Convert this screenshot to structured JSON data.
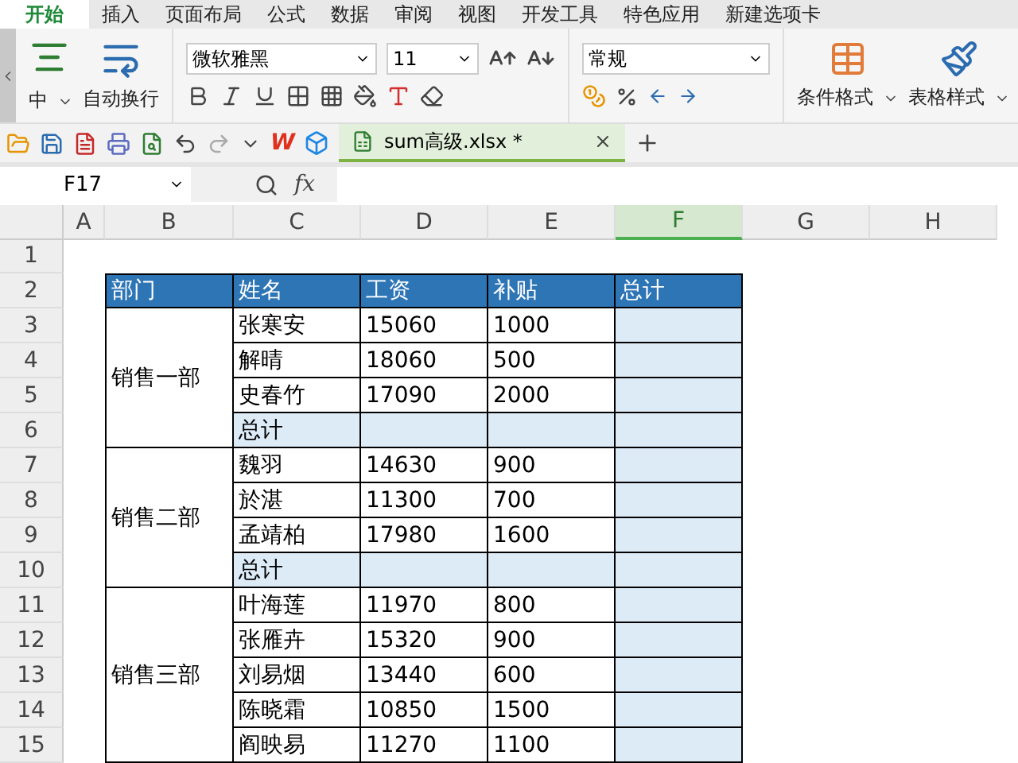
{
  "ribbon_tabs": [
    {
      "label": "开始",
      "selected": true
    },
    {
      "label": "插入",
      "selected": false
    },
    {
      "label": "页面布局",
      "selected": false
    },
    {
      "label": "公式",
      "selected": false
    },
    {
      "label": "数据",
      "selected": false
    },
    {
      "label": "审阅",
      "selected": false
    },
    {
      "label": "视图",
      "selected": false
    },
    {
      "label": "开发工具",
      "selected": false
    },
    {
      "label": "特色应用",
      "selected": false
    },
    {
      "label": "新建选项卡",
      "selected": false
    }
  ],
  "ribbon": {
    "merge_label": "中",
    "wrap_label": "自动换行",
    "font": "微软雅黑",
    "font_size": "11",
    "number_format": "常规",
    "conditional_format": "条件格式",
    "table_style": "表格样式"
  },
  "quick_toolbar": {
    "logo": "W",
    "document_tab": {
      "title": "sum高级.xlsx *"
    }
  },
  "formula_bar": {
    "name_box": "F17",
    "function_label": "fx"
  },
  "sheet": {
    "columns": [
      {
        "label": "A",
        "selected": false
      },
      {
        "label": "B",
        "selected": false
      },
      {
        "label": "C",
        "selected": false
      },
      {
        "label": "D",
        "selected": false
      },
      {
        "label": "E",
        "selected": false
      },
      {
        "label": "F",
        "selected": true
      },
      {
        "label": "G",
        "selected": false
      },
      {
        "label": "H",
        "selected": false
      }
    ],
    "row_numbers": [
      "1",
      "2",
      "3",
      "4",
      "5",
      "6",
      "7",
      "8",
      "9",
      "10",
      "11",
      "12",
      "13",
      "14",
      "15"
    ],
    "header": [
      "部门",
      "姓名",
      "工资",
      "补贴",
      "总计"
    ],
    "groups": [
      {
        "department": "销售一部",
        "rows": [
          {
            "kind": "person",
            "cells": [
              "张寒安",
              "15060",
              "1000"
            ]
          },
          {
            "kind": "person",
            "cells": [
              "解晴",
              "18060",
              "500"
            ]
          },
          {
            "kind": "person",
            "cells": [
              "史春竹",
              "17090",
              "2000"
            ]
          },
          {
            "kind": "subtotal",
            "cells": [
              "总计"
            ]
          }
        ]
      },
      {
        "department": "销售二部",
        "rows": [
          {
            "kind": "person",
            "cells": [
              "魏羽",
              "14630",
              "900"
            ]
          },
          {
            "kind": "person",
            "cells": [
              "於湛",
              "11300",
              "700"
            ]
          },
          {
            "kind": "person",
            "cells": [
              "孟靖柏",
              "17980",
              "1600"
            ]
          },
          {
            "kind": "subtotal",
            "cells": [
              "总计"
            ]
          }
        ]
      },
      {
        "department": "销售三部",
        "rows": [
          {
            "kind": "person",
            "cells": [
              "叶海莲",
              "11970",
              "800"
            ]
          },
          {
            "kind": "person",
            "cells": [
              "张雁卉",
              "15320",
              "900"
            ]
          },
          {
            "kind": "person",
            "cells": [
              "刘易烟",
              "13440",
              "600"
            ]
          },
          {
            "kind": "person",
            "cells": [
              "陈晓霜",
              "10850",
              "1500"
            ]
          },
          {
            "kind": "person",
            "cells": [
              "阎映易",
              "11270",
              "1100"
            ]
          }
        ]
      }
    ]
  }
}
